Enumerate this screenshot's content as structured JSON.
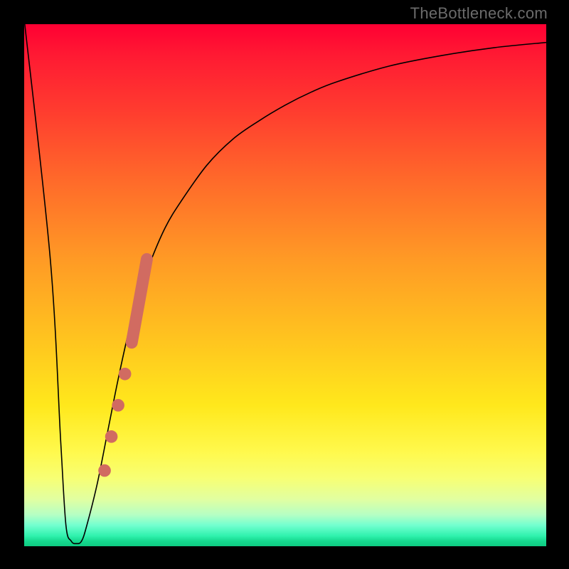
{
  "watermark": "TheBottleneck.com",
  "colors": {
    "frame": "#000000",
    "curve": "#000000",
    "markers": "#d16b61",
    "gradient_stops": [
      {
        "pct": 0,
        "hex": "#ff0033"
      },
      {
        "pct": 16,
        "hex": "#ff3a2f"
      },
      {
        "pct": 30,
        "hex": "#ff6a2a"
      },
      {
        "pct": 45,
        "hex": "#ff9a25"
      },
      {
        "pct": 60,
        "hex": "#ffc31f"
      },
      {
        "pct": 73,
        "hex": "#ffe81c"
      },
      {
        "pct": 87,
        "hex": "#f7ff74"
      },
      {
        "pct": 94,
        "hex": "#b5ffc4"
      },
      {
        "pct": 100,
        "hex": "#0ecb82"
      }
    ]
  },
  "chart_data": {
    "type": "line",
    "title": "",
    "xlabel": "",
    "ylabel": "",
    "xlim": [
      0,
      100
    ],
    "ylim": [
      0,
      100
    ],
    "x": [
      0,
      5,
      7,
      8,
      9,
      10,
      11,
      12,
      14,
      16,
      18,
      20,
      22,
      24,
      27,
      30,
      35,
      40,
      45,
      50,
      55,
      60,
      70,
      80,
      90,
      100
    ],
    "values": [
      101,
      55,
      20,
      4,
      1,
      0.5,
      1,
      4,
      12,
      22,
      32,
      41,
      48,
      54,
      61,
      66,
      73,
      78,
      81.5,
      84.5,
      87,
      89,
      92,
      94,
      95.5,
      96.5
    ],
    "markers": {
      "bar_segment": {
        "x": 21.2,
        "y_from": 39,
        "y_to": 55,
        "width": 2.3
      },
      "dots": [
        {
          "x": 19.3,
          "y": 33
        },
        {
          "x": 18.0,
          "y": 27
        },
        {
          "x": 16.7,
          "y": 21
        },
        {
          "x": 15.4,
          "y": 14.5
        }
      ],
      "dot_radius": 1.2
    }
  }
}
